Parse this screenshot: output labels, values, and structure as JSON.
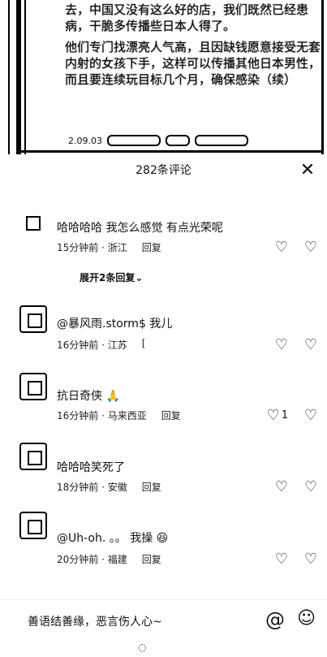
{
  "post": {
    "paragraph1": "去，中国又没有这么好的店，我们既然已经患病，干脆多传播些日本人得了。",
    "paragraph2": "他们专门找漂亮人气高，且因缺钱愿意接受无套内射的女孩下手，这样可以传播其他日本男性，而且要连续玩目标几个月，确保感染（续）",
    "date": "2.09.03"
  },
  "sheet": {
    "title": "282条评论",
    "close_icon": "close-icon"
  },
  "comments": [
    {
      "text": "哈哈哈哈 我怎么感觉 有点光荣呢",
      "time": "15分钟前 · 浙江",
      "reply": "回复",
      "likes": ""
    },
    {
      "text": "@暴风雨.storm$ 我儿",
      "time": "16分钟前 · 江苏",
      "reply": "[",
      "likes": ""
    },
    {
      "text": "抗日奇侠 🙏",
      "time": "16分钟前 · 马来西亚",
      "reply": "回复",
      "likes": "1"
    },
    {
      "text": "哈哈哈笑死了",
      "time": "18分钟前 · 安徽",
      "reply": "回复",
      "likes": ""
    },
    {
      "text": "@Uh-oh. 。。 我操 😆",
      "time": "20分钟前 · 福建",
      "reply": "回复",
      "likes": ""
    }
  ],
  "expand_label": "展开2条回复⌄",
  "input": {
    "placeholder": "善语结善缘，恶言伤人心~"
  }
}
